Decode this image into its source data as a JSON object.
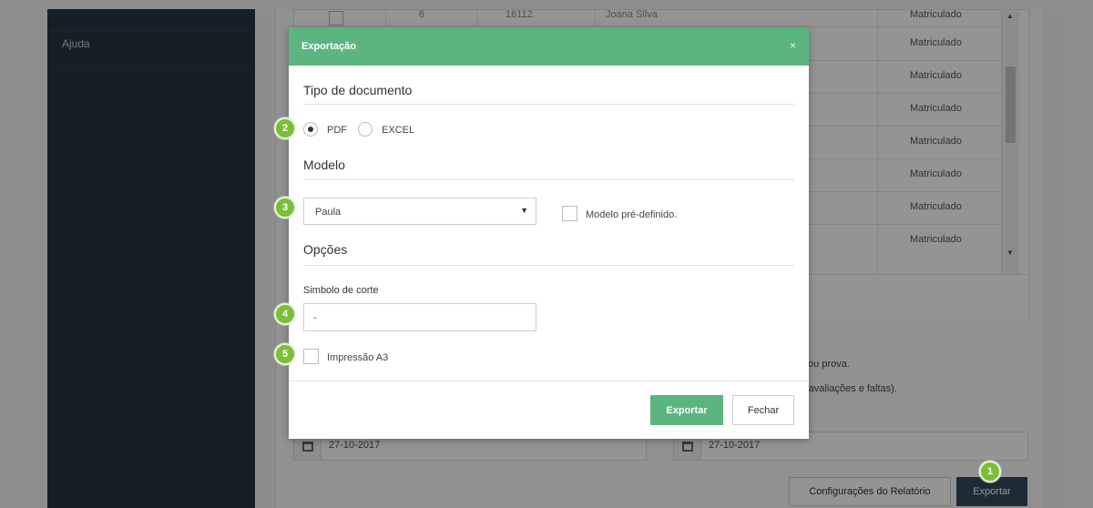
{
  "sidebar": {
    "items": [
      {
        "label": "Ajuda"
      }
    ]
  },
  "table": {
    "first_row": {
      "num": "6",
      "code": "16112",
      "name": "Joana Silva"
    },
    "status_values": [
      "Matriculado",
      "Matriculado",
      "Matriculado",
      "Matriculado",
      "Matriculado",
      "Matriculado",
      "Matriculado",
      "Matriculado"
    ]
  },
  "background": {
    "text_line_1": "/ou prova.",
    "text_line_2": "(avaliações e faltas).",
    "date_from": "27-10-2017",
    "date_to": "27-10-2017",
    "config_button": "Configurações do Relatório",
    "export_button": "Exportar"
  },
  "modal": {
    "title": "Exportação",
    "close_glyph": "×",
    "doc_type": {
      "title": "Tipo de documento",
      "options": [
        {
          "label": "PDF",
          "selected": true
        },
        {
          "label": "EXCEL",
          "selected": false
        }
      ]
    },
    "model": {
      "title": "Modelo",
      "selected": "Paula",
      "predefined_label": "Modelo pré-definido.",
      "predefined_checked": false
    },
    "options": {
      "title": "Opções",
      "cut_symbol_label": "Simbolo de corte",
      "cut_symbol_value": "-",
      "a3_label": "Impressão A3",
      "a3_checked": false
    },
    "export_button": "Exportar",
    "close_button": "Fechar"
  },
  "badges": [
    "1",
    "2",
    "3",
    "4",
    "5"
  ],
  "colors": {
    "header_green": "#5cb57e",
    "badge_green": "#7bbe3a",
    "sidebar": "#273443",
    "export_dark": "#34495e"
  }
}
